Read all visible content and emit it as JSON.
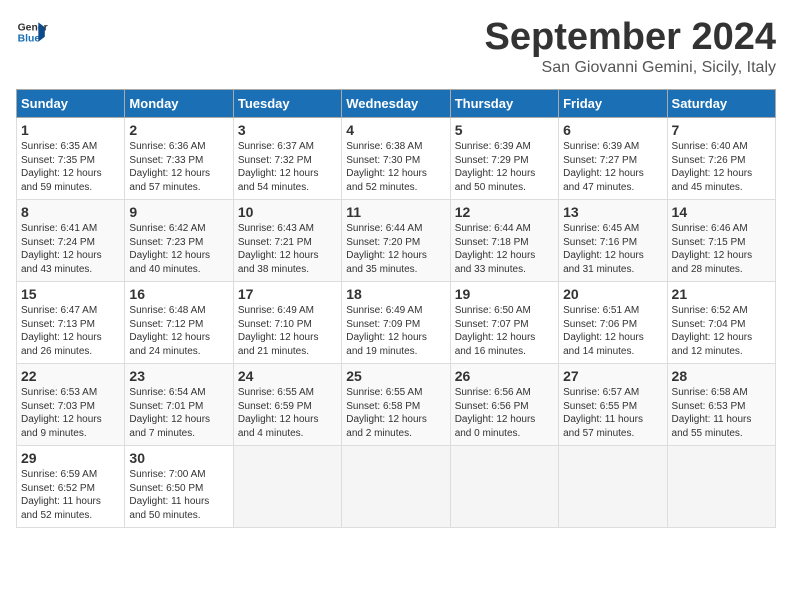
{
  "logo": {
    "line1": "General",
    "line2": "Blue"
  },
  "title": "September 2024",
  "subtitle": "San Giovanni Gemini, Sicily, Italy",
  "headers": [
    "Sunday",
    "Monday",
    "Tuesday",
    "Wednesday",
    "Thursday",
    "Friday",
    "Saturday"
  ],
  "weeks": [
    [
      {
        "day": "1",
        "text": "Sunrise: 6:35 AM\nSunset: 7:35 PM\nDaylight: 12 hours\nand 59 minutes."
      },
      {
        "day": "2",
        "text": "Sunrise: 6:36 AM\nSunset: 7:33 PM\nDaylight: 12 hours\nand 57 minutes."
      },
      {
        "day": "3",
        "text": "Sunrise: 6:37 AM\nSunset: 7:32 PM\nDaylight: 12 hours\nand 54 minutes."
      },
      {
        "day": "4",
        "text": "Sunrise: 6:38 AM\nSunset: 7:30 PM\nDaylight: 12 hours\nand 52 minutes."
      },
      {
        "day": "5",
        "text": "Sunrise: 6:39 AM\nSunset: 7:29 PM\nDaylight: 12 hours\nand 50 minutes."
      },
      {
        "day": "6",
        "text": "Sunrise: 6:39 AM\nSunset: 7:27 PM\nDaylight: 12 hours\nand 47 minutes."
      },
      {
        "day": "7",
        "text": "Sunrise: 6:40 AM\nSunset: 7:26 PM\nDaylight: 12 hours\nand 45 minutes."
      }
    ],
    [
      {
        "day": "8",
        "text": "Sunrise: 6:41 AM\nSunset: 7:24 PM\nDaylight: 12 hours\nand 43 minutes."
      },
      {
        "day": "9",
        "text": "Sunrise: 6:42 AM\nSunset: 7:23 PM\nDaylight: 12 hours\nand 40 minutes."
      },
      {
        "day": "10",
        "text": "Sunrise: 6:43 AM\nSunset: 7:21 PM\nDaylight: 12 hours\nand 38 minutes."
      },
      {
        "day": "11",
        "text": "Sunrise: 6:44 AM\nSunset: 7:20 PM\nDaylight: 12 hours\nand 35 minutes."
      },
      {
        "day": "12",
        "text": "Sunrise: 6:44 AM\nSunset: 7:18 PM\nDaylight: 12 hours\nand 33 minutes."
      },
      {
        "day": "13",
        "text": "Sunrise: 6:45 AM\nSunset: 7:16 PM\nDaylight: 12 hours\nand 31 minutes."
      },
      {
        "day": "14",
        "text": "Sunrise: 6:46 AM\nSunset: 7:15 PM\nDaylight: 12 hours\nand 28 minutes."
      }
    ],
    [
      {
        "day": "15",
        "text": "Sunrise: 6:47 AM\nSunset: 7:13 PM\nDaylight: 12 hours\nand 26 minutes."
      },
      {
        "day": "16",
        "text": "Sunrise: 6:48 AM\nSunset: 7:12 PM\nDaylight: 12 hours\nand 24 minutes."
      },
      {
        "day": "17",
        "text": "Sunrise: 6:49 AM\nSunset: 7:10 PM\nDaylight: 12 hours\nand 21 minutes."
      },
      {
        "day": "18",
        "text": "Sunrise: 6:49 AM\nSunset: 7:09 PM\nDaylight: 12 hours\nand 19 minutes."
      },
      {
        "day": "19",
        "text": "Sunrise: 6:50 AM\nSunset: 7:07 PM\nDaylight: 12 hours\nand 16 minutes."
      },
      {
        "day": "20",
        "text": "Sunrise: 6:51 AM\nSunset: 7:06 PM\nDaylight: 12 hours\nand 14 minutes."
      },
      {
        "day": "21",
        "text": "Sunrise: 6:52 AM\nSunset: 7:04 PM\nDaylight: 12 hours\nand 12 minutes."
      }
    ],
    [
      {
        "day": "22",
        "text": "Sunrise: 6:53 AM\nSunset: 7:03 PM\nDaylight: 12 hours\nand 9 minutes."
      },
      {
        "day": "23",
        "text": "Sunrise: 6:54 AM\nSunset: 7:01 PM\nDaylight: 12 hours\nand 7 minutes."
      },
      {
        "day": "24",
        "text": "Sunrise: 6:55 AM\nSunset: 6:59 PM\nDaylight: 12 hours\nand 4 minutes."
      },
      {
        "day": "25",
        "text": "Sunrise: 6:55 AM\nSunset: 6:58 PM\nDaylight: 12 hours\nand 2 minutes."
      },
      {
        "day": "26",
        "text": "Sunrise: 6:56 AM\nSunset: 6:56 PM\nDaylight: 12 hours\nand 0 minutes."
      },
      {
        "day": "27",
        "text": "Sunrise: 6:57 AM\nSunset: 6:55 PM\nDaylight: 11 hours\nand 57 minutes."
      },
      {
        "day": "28",
        "text": "Sunrise: 6:58 AM\nSunset: 6:53 PM\nDaylight: 11 hours\nand 55 minutes."
      }
    ],
    [
      {
        "day": "29",
        "text": "Sunrise: 6:59 AM\nSunset: 6:52 PM\nDaylight: 11 hours\nand 52 minutes."
      },
      {
        "day": "30",
        "text": "Sunrise: 7:00 AM\nSunset: 6:50 PM\nDaylight: 11 hours\nand 50 minutes."
      },
      {
        "day": "",
        "text": ""
      },
      {
        "day": "",
        "text": ""
      },
      {
        "day": "",
        "text": ""
      },
      {
        "day": "",
        "text": ""
      },
      {
        "day": "",
        "text": ""
      }
    ]
  ]
}
